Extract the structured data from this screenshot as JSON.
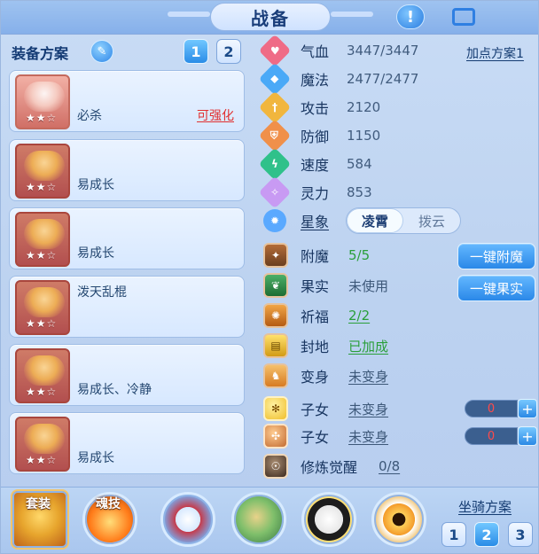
{
  "header": {
    "title": "战备"
  },
  "left": {
    "title": "装备方案",
    "tabs": [
      "1",
      "2"
    ],
    "equipment": [
      {
        "name": "必杀",
        "action": "可强化",
        "stars": "★★☆"
      },
      {
        "name": "易成长",
        "stars": "★★☆"
      },
      {
        "name": "易成长",
        "stars": "★★☆"
      },
      {
        "name": "泼天乱棍",
        "stars": "★★☆"
      },
      {
        "name": "易成长、冷静",
        "stars": "★★☆"
      },
      {
        "name": "易成长",
        "stars": "★★☆"
      }
    ]
  },
  "stats": {
    "allocation_plan": "加点方案1",
    "rows": [
      {
        "label": "气血",
        "value": "3447/3447"
      },
      {
        "label": "魔法",
        "value": "2477/2477"
      },
      {
        "label": "攻击",
        "value": "2120"
      },
      {
        "label": "防御",
        "value": "1150"
      },
      {
        "label": "速度",
        "value": "584"
      },
      {
        "label": "灵力",
        "value": "853"
      }
    ],
    "star_label": "星象",
    "star_options": [
      "凌霄",
      "拨云"
    ]
  },
  "features": {
    "rows": [
      {
        "label": "附魔",
        "value": "5/5"
      },
      {
        "label": "果实",
        "value": "未使用"
      },
      {
        "label": "祈福",
        "value": "2/2"
      },
      {
        "label": "封地",
        "value": "已加成"
      },
      {
        "label": "变身",
        "value": "未变身"
      },
      {
        "label": "子女",
        "value": "未变身"
      },
      {
        "label": "子女",
        "value": "未变身"
      },
      {
        "label": "修炼觉醒",
        "value": "0/8"
      }
    ],
    "buttons": {
      "enchant": "一键附魔",
      "fruit": "一键果实"
    },
    "counters": [
      "0",
      "0"
    ],
    "plus": "+"
  },
  "bottom": {
    "orbs": [
      "套装",
      "魂技"
    ],
    "mount_title": "坐骑方案",
    "mount_tabs": [
      "1",
      "2",
      "3"
    ]
  },
  "icons": {
    "help": "!"
  }
}
